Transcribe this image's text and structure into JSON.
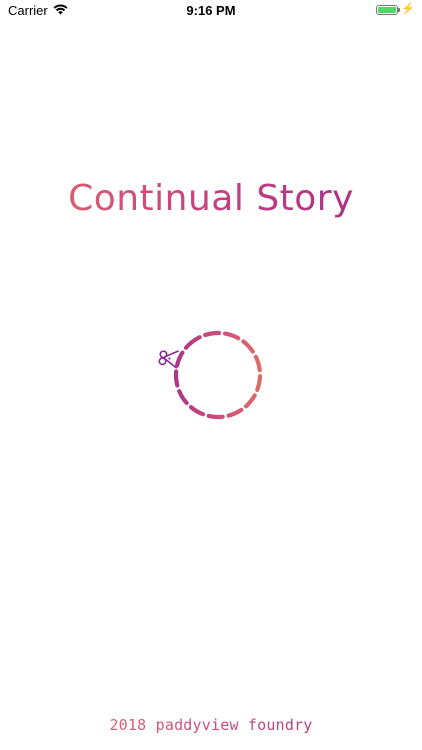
{
  "status_bar": {
    "carrier": "Carrier",
    "time": "9:16 PM",
    "wifi_icon": "wifi-icon",
    "battery_icon": "battery-icon",
    "charging_icon": "charging-icon",
    "battery_level": 1.0,
    "charging_symbol": "⚡"
  },
  "app": {
    "title": "Continual Story",
    "paw_icon": "paw-icon",
    "loading_icon": "scissors-loading-icon",
    "footer": "2018 paddyview foundry"
  },
  "colors": {
    "brand_start": "#e26b63",
    "brand_mid": "#c9437f",
    "brand_end": "#9b2c87"
  }
}
